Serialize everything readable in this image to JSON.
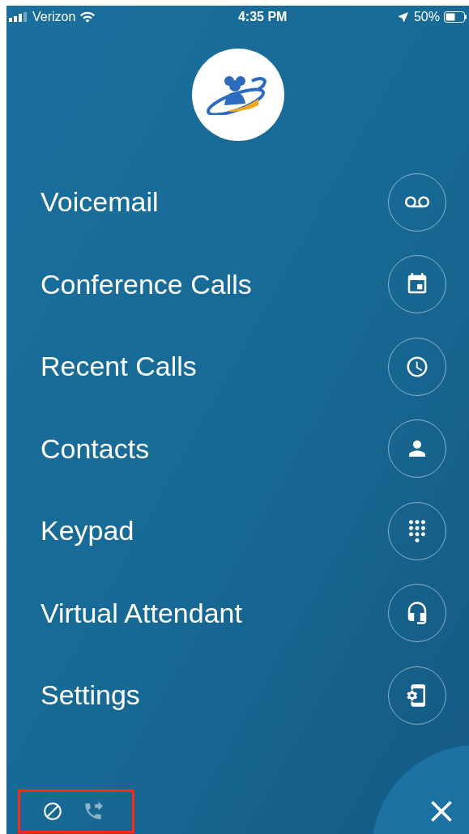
{
  "status_bar": {
    "carrier": "Verizon",
    "time": "4:35 PM",
    "battery": "50%"
  },
  "menu": [
    {
      "label": "Voicemail"
    },
    {
      "label": "Conference Calls"
    },
    {
      "label": "Recent Calls"
    },
    {
      "label": "Contacts"
    },
    {
      "label": "Keypad"
    },
    {
      "label": "Virtual Attendant"
    },
    {
      "label": "Settings"
    }
  ],
  "bottom_toggles": [
    {
      "kind": "do-not-disturb",
      "disabled": false
    },
    {
      "kind": "call-forward",
      "disabled": true
    }
  ]
}
